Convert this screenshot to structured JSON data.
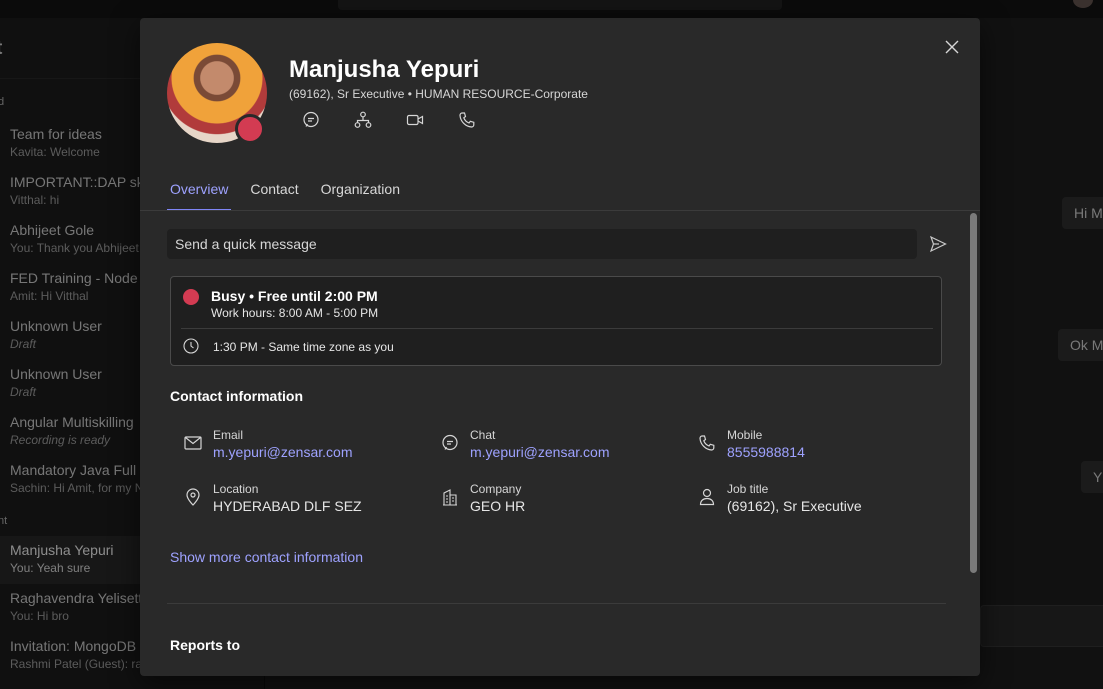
{
  "background": {
    "left_title": "t",
    "sections": [
      "d",
      "nt"
    ],
    "chats": [
      {
        "name": "Team for ideas",
        "preview": "Kavita: Welcome",
        "italic": false
      },
      {
        "name": "IMPORTANT::DAP skil",
        "preview": "Vitthal: hi",
        "italic": false
      },
      {
        "name": "Abhijeet Gole",
        "preview": "You: Thank you Abhijeet",
        "italic": false
      },
      {
        "name": "FED Training - Node",
        "preview": "Amit: Hi Vitthal",
        "italic": false
      },
      {
        "name": "Unknown User",
        "preview": "Draft",
        "italic": true
      },
      {
        "name": "Unknown User",
        "preview": "Draft",
        "italic": true
      },
      {
        "name": "Angular Multiskilling",
        "preview": "Recording is ready",
        "italic": true
      },
      {
        "name": "Mandatory Java Full S",
        "preview": "Sachin: Hi Amit, for my N",
        "italic": false
      },
      {
        "name": "Manjusha Yepuri",
        "preview": "You: Yeah sure",
        "italic": false
      },
      {
        "name": "Raghavendra Yelisetty",
        "preview": "You: Hi bro",
        "italic": false
      },
      {
        "name": "Invitation: MongoDB",
        "preview": "Rashmi Patel (Guest): ras",
        "italic": false
      }
    ],
    "bubbles": [
      "Hi M",
      "Ok M",
      "Y"
    ]
  },
  "profile": {
    "name": "Manjusha Yepuri",
    "subtitle": "(69162), Sr Executive • HUMAN RESOURCE-Corporate",
    "presence_color": "#d33b52",
    "actions": [
      "chat-icon",
      "org-chart-icon",
      "video-call-icon",
      "phone-icon"
    ],
    "tabs": [
      "Overview",
      "Contact",
      "Organization"
    ],
    "active_tab": "Overview",
    "quick_message": {
      "placeholder": "Send a quick message"
    },
    "status": {
      "line": "Busy • Free until 2:00 PM",
      "work_hours": "Work hours: 8:00 AM - 5:00 PM",
      "timezone": "1:30 PM - Same time zone as you"
    },
    "contact_title": "Contact information",
    "contact": {
      "email": {
        "label": "Email",
        "value": "m.yepuri@zensar.com"
      },
      "chat": {
        "label": "Chat",
        "value": "m.yepuri@zensar.com"
      },
      "mobile": {
        "label": "Mobile",
        "value": "8555988814"
      },
      "location": {
        "label": "Location",
        "value": "HYDERABAD DLF SEZ"
      },
      "company": {
        "label": "Company",
        "value": "GEO HR"
      },
      "job_title": {
        "label": "Job title",
        "value": "(69162), Sr Executive"
      }
    },
    "show_more": "Show more contact information",
    "reports_to_title": "Reports to",
    "accent_color": "#7f85f5"
  }
}
